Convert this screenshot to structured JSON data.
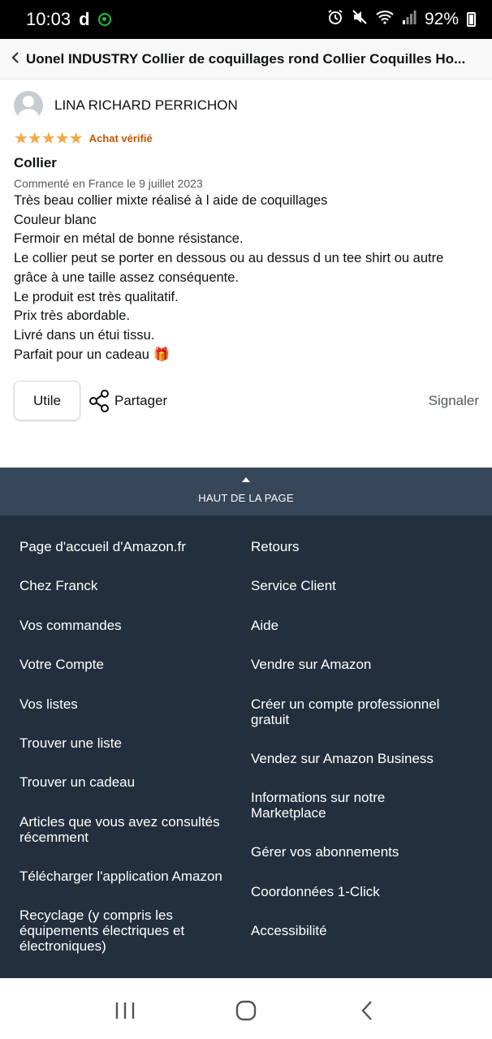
{
  "status_bar": {
    "time": "10:03",
    "app_letter": "d",
    "battery": "92%"
  },
  "header": {
    "title": "Uonel INDUSTRY Collier de coquillages rond Collier Coquilles Ho..."
  },
  "review": {
    "reviewer_name": "LINA RICHARD PERRICHON",
    "rating": 5,
    "stars": "★★★★★",
    "verified": "Achat vérifié",
    "title": "Collier",
    "date": "Commenté en France le 9 juillet 2023",
    "body_lines": [
      "Très beau collier mixte réalisé à l aide de coquillages",
      "Couleur blanc",
      "Fermoir en métal de bonne résistance.",
      "Le collier peut se porter en dessous ou au dessus d un tee shirt ou autre",
      "grâce à une taille assez conséquente.",
      "Le produit est très qualitatif.",
      "Prix très abordable.",
      "Livré dans un étui tissu.",
      "Parfait pour un cadeau 🎁"
    ],
    "helpful_label": "Utile",
    "share_label": "Partager",
    "report_label": "Signaler"
  },
  "back_to_top": {
    "label": "HAUT DE LA PAGE"
  },
  "footer": {
    "left": [
      "Page d'accueil d'Amazon.fr",
      "Chez Franck",
      "Vos commandes",
      "Votre Compte",
      "Vos listes",
      "Trouver une liste",
      "Trouver un cadeau",
      "Articles que vous avez consultés récemment",
      "Télécharger l'application Amazon",
      "Recyclage (y compris les équipements électriques et électroniques)"
    ],
    "right": [
      "Retours",
      "Service Client",
      "Aide",
      "Vendre sur Amazon",
      "Créer un compte professionnel gratuit",
      "Vendez sur Amazon Business",
      "Informations sur notre Marketplace",
      "Gérer vos abonnements",
      "Coordonnées 1-Click",
      "Accessibilité"
    ]
  },
  "colors": {
    "star": "#f3a847",
    "verified": "#c45500",
    "footer_bg": "#232f3e",
    "back_top_bg": "#37475a"
  }
}
